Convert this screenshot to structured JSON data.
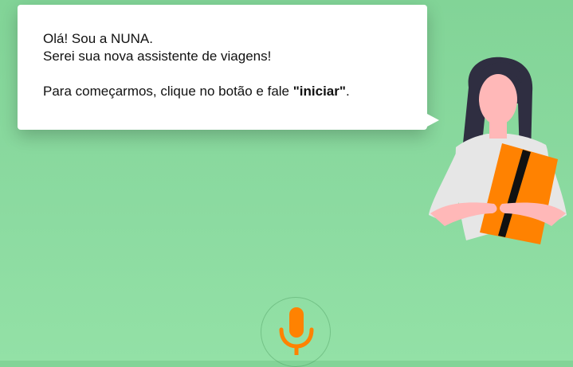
{
  "dialog": {
    "line1": "Olá! Sou a NUNA.",
    "line2": "Serei sua nova assistente de viagens!",
    "line3_prefix": "Para começarmos, clique no botão e fale ",
    "line3_keyword": "\"iniciar\"",
    "line3_suffix": "."
  },
  "mic_button": {
    "icon": "microphone-icon"
  },
  "colors": {
    "background": "#86d69b",
    "accent": "#ff8201",
    "bubble": "#ffffff",
    "hair": "#2f2e41",
    "skin": "#ffb8b8"
  }
}
